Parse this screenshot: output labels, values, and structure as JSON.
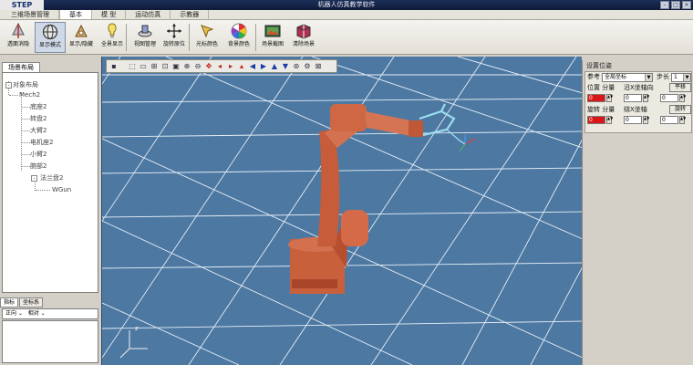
{
  "window": {
    "logo": "STEP",
    "title": "机器人仿真教学软件"
  },
  "menu_tabs": [
    "三维场景管理",
    "基本",
    "模 型",
    "运动仿真",
    "示教器"
  ],
  "toolbar": [
    {
      "label": "透面消隐",
      "icon": "hide-surface-icon"
    },
    {
      "label": "显示模式",
      "icon": "display-mode-icon"
    },
    {
      "label": "显示/隐藏",
      "icon": "show-hide-icon"
    },
    {
      "label": "全景显示",
      "icon": "panorama-icon"
    },
    {
      "label": "视图管理",
      "icon": "view-manage-icon"
    },
    {
      "label": "旋转原位",
      "icon": "rotate-home-icon"
    },
    {
      "label": "光标颜色",
      "icon": "cursor-color-icon"
    },
    {
      "label": "背景颜色",
      "icon": "background-color-icon"
    },
    {
      "label": "场景截图",
      "icon": "scene-capture-icon"
    },
    {
      "label": "清除场景",
      "icon": "clear-scene-icon"
    }
  ],
  "left_panel": {
    "tab": "场景布局",
    "tree": {
      "root": "对象布局",
      "mech": "Mech2",
      "children": [
        "底座2",
        "转盘2",
        "大臂2",
        "电机座2",
        "小臂2",
        "腕部2"
      ],
      "flange": "法兰盘2",
      "tool": "WGun"
    },
    "bottom_tabs": [
      "指标",
      "坐标系"
    ],
    "coord_bar": {
      "item1": "正向",
      "item2": "相对"
    }
  },
  "viewport": {
    "bg_color": "#4c78a2",
    "axis_label": "z"
  },
  "right_panel": {
    "title": "设置位姿",
    "ref_label": "参考",
    "ref_value": "全局坐标",
    "step_label": "步长",
    "step_value": "1",
    "pos_label": "位置 分量",
    "pos_axis": "沿X坐轴向",
    "pos_button": "平移",
    "pos_values": [
      "0",
      "0",
      "0"
    ],
    "rot_label": "旋转 分量",
    "rot_axis": "绕X坐轴",
    "rot_button": "旋转",
    "rot_values": [
      "0",
      "0",
      "0"
    ]
  }
}
